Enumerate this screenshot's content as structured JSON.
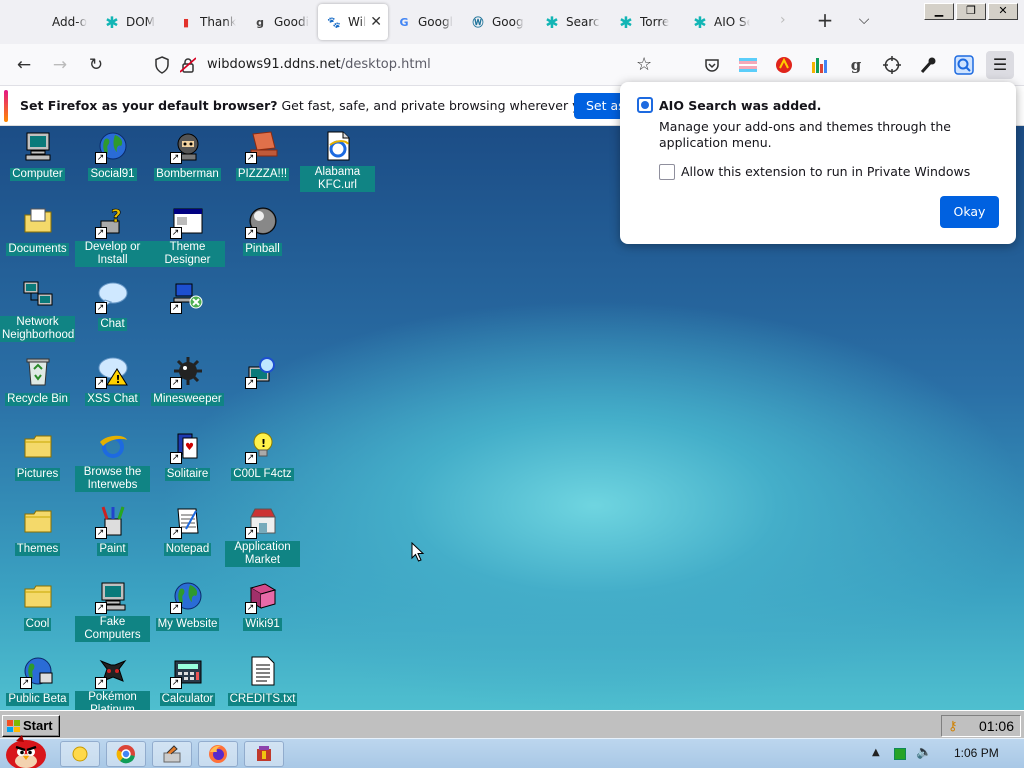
{
  "browser": {
    "tabs": [
      {
        "title": "Add-o",
        "icon": "back-chevron-icon",
        "color": "#333333"
      },
      {
        "title": "DOM",
        "icon": "aio-icon",
        "color": "#12b5b5"
      },
      {
        "title": "Thank",
        "icon": "chart-bars-icon",
        "color": "#e2312b"
      },
      {
        "title": "Goodi",
        "icon": "g-letter-icon",
        "color": "#444444"
      },
      {
        "title": "Wil",
        "icon": "paw-icon",
        "color": "#222222",
        "active": true
      },
      {
        "title": "Googl",
        "icon": "google-icon",
        "color": "#4285f4"
      },
      {
        "title": "Goog",
        "icon": "wordpress-icon",
        "color": "#21759b"
      },
      {
        "title": "Searc",
        "icon": "aio-icon",
        "color": "#12b5b5"
      },
      {
        "title": "Torre",
        "icon": "aio-icon",
        "color": "#12b5b5"
      },
      {
        "title": "AIO Se",
        "icon": "aio-icon",
        "color": "#12b5b5"
      }
    ],
    "close_glyph": "✕",
    "url_host": "wibdows91.ddns.net",
    "url_path": "/desktop.html",
    "toolbar_icons": [
      "pocket-icon",
      "extension-flag-icon",
      "extension-red-icon",
      "extension-bars-icon",
      "extension-g-icon",
      "extension-crosshair-icon",
      "extension-wand-icon",
      "aio-search-icon"
    ]
  },
  "notification": {
    "bold": "Set Firefox as your default browser?",
    "rest": " Get fast, safe, and private browsing wherever you use the web.",
    "button": "Set as"
  },
  "popup": {
    "title": "AIO Search was added.",
    "body": "Manage your add-ons and themes through the application menu.",
    "checkbox_label": "Allow this extension to run in Private Windows",
    "okay": "Okay"
  },
  "desktop": {
    "icons": [
      {
        "label": "Computer",
        "icon": "computer-icon",
        "shortcut": false
      },
      {
        "label": "Social91",
        "icon": "globe-icon",
        "shortcut": true
      },
      {
        "label": "Bomberman",
        "icon": "bomberman-icon",
        "shortcut": true
      },
      {
        "label": "PIZZZA!!!",
        "icon": "pizza-laptop-icon",
        "shortcut": true
      },
      {
        "label": "Alabama KFC.url",
        "icon": "ie-document-icon",
        "shortcut": false
      },
      {
        "label": "Documents",
        "icon": "documents-folder-icon",
        "shortcut": false
      },
      {
        "label": "Develop or Install",
        "icon": "help-install-icon",
        "shortcut": true
      },
      {
        "label": "Theme Designer",
        "icon": "window-icon",
        "shortcut": true
      },
      {
        "label": "Pinball",
        "icon": "pinball-icon",
        "shortcut": true
      },
      {
        "label": "Network Neighborhood",
        "icon": "network-icon",
        "shortcut": false
      },
      {
        "label": "Chat",
        "icon": "chat-bubble-icon",
        "shortcut": true
      },
      {
        "label": "",
        "icon": "network-error-icon",
        "shortcut": true
      },
      {
        "label": "Recycle Bin",
        "icon": "recycle-bin-icon",
        "shortcut": false
      },
      {
        "label": "XSS Chat",
        "icon": "chat-warning-icon",
        "shortcut": true
      },
      {
        "label": "Minesweeper",
        "icon": "mine-icon",
        "shortcut": true
      },
      {
        "label": "",
        "icon": "network-search-icon",
        "shortcut": true
      },
      {
        "label": "Pictures",
        "icon": "folder-icon",
        "shortcut": false
      },
      {
        "label": "Browse the Interwebs",
        "icon": "ie-icon",
        "shortcut": false
      },
      {
        "label": "Solitaire",
        "icon": "solitaire-icon",
        "shortcut": true
      },
      {
        "label": "C00L F4ctz",
        "icon": "lightbulb-icon",
        "shortcut": true
      },
      {
        "label": "Themes",
        "icon": "folder-icon",
        "shortcut": false
      },
      {
        "label": "Paint",
        "icon": "paint-icon",
        "shortcut": true
      },
      {
        "label": "Notepad",
        "icon": "notepad-icon",
        "shortcut": true
      },
      {
        "label": "Application Market",
        "icon": "market-icon",
        "shortcut": true
      },
      {
        "label": "Cool",
        "icon": "folder-icon",
        "shortcut": false
      },
      {
        "label": "Fake Computers",
        "icon": "computer-icon",
        "shortcut": true
      },
      {
        "label": "My Website",
        "icon": "globe-icon",
        "shortcut": true
      },
      {
        "label": "Wiki91",
        "icon": "book-icon",
        "shortcut": true
      },
      {
        "label": "Public Beta",
        "icon": "globe-network-icon",
        "shortcut": true
      },
      {
        "label": "Pokémon Platinum",
        "icon": "pokemon-icon",
        "shortcut": true
      },
      {
        "label": "Calculator",
        "icon": "calculator-icon",
        "shortcut": true
      },
      {
        "label": "CREDITS.txt",
        "icon": "text-file-icon",
        "shortcut": false
      }
    ]
  },
  "taskbar98": {
    "start": "Start",
    "clock": "01:06"
  },
  "host_taskbar": {
    "apps": [
      "explorer-icon",
      "chrome-icon",
      "photo-editor-icon",
      "firefox-icon",
      "archive-icon"
    ],
    "time": "1:06 PM"
  }
}
